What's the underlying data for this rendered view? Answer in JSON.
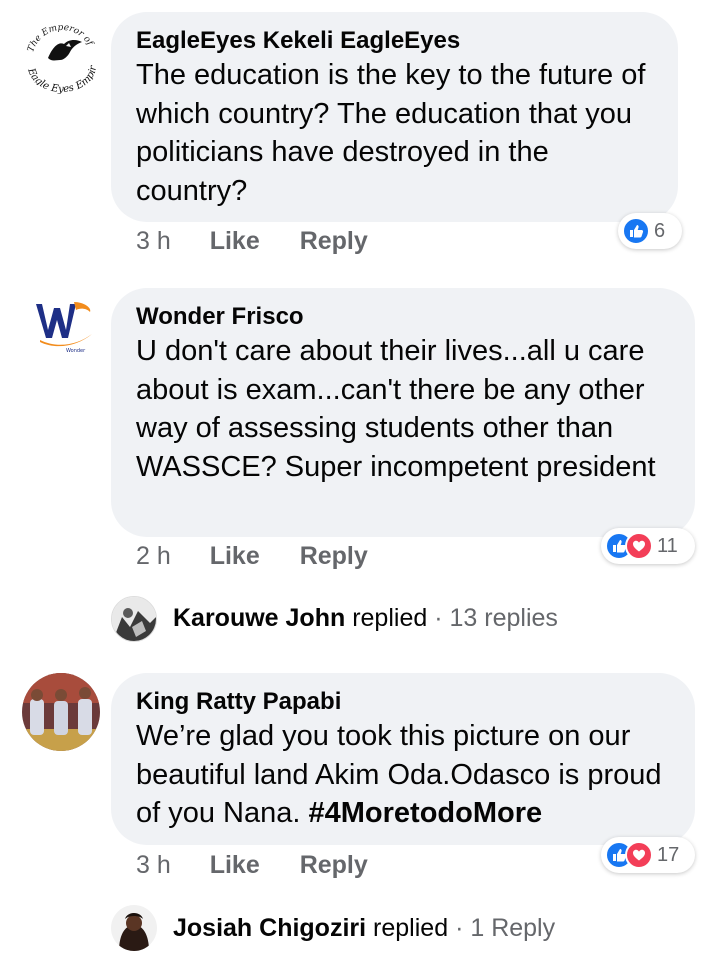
{
  "comments": [
    {
      "author": "EagleEyes Kekeli EagleEyes",
      "avatar_logo_text": "The Emperor of Eagle Eyes Empire",
      "text": "The education is the key to the future of which country? The education that you politicians have destroyed in the country?",
      "time": "3 h",
      "like_label": "Like",
      "reply_label": "Reply",
      "reaction_count": "6",
      "reactions": [
        "like"
      ]
    },
    {
      "author": "Wonder Frisco",
      "avatar_logo_text": "Wonder Frisco",
      "text": "U don't care about their lives...all u care about is exam...can't there be any other way of assessing students other than WASSCE? Super incompetent president",
      "time": "2 h",
      "like_label": "Like",
      "reply_label": "Reply",
      "reaction_count": "11",
      "reactions": [
        "like",
        "love"
      ],
      "replies": {
        "name": "Karouwe John",
        "verb": "replied",
        "separator": "·",
        "count": "13 replies"
      }
    },
    {
      "author": "King Ratty Papabi",
      "text_plain": "We’re glad you took this picture on our beautiful land Akim Oda.Odasco is proud of you Nana.",
      "hashtag": "#4MoretodoMore",
      "time": "3 h",
      "like_label": "Like",
      "reply_label": "Reply",
      "reaction_count": "17",
      "reactions": [
        "like",
        "love"
      ],
      "replies": {
        "name": "Josiah Chigoziri",
        "verb": "replied",
        "separator": "·",
        "count": "1 Reply"
      }
    }
  ],
  "colors": {
    "bubble": "#f0f2f5",
    "meta_text": "#65676b",
    "like_blue": "#1877f2",
    "love_red": "#f33e58"
  },
  "icons": {
    "like": "thumbs-up-icon",
    "love": "heart-icon"
  }
}
